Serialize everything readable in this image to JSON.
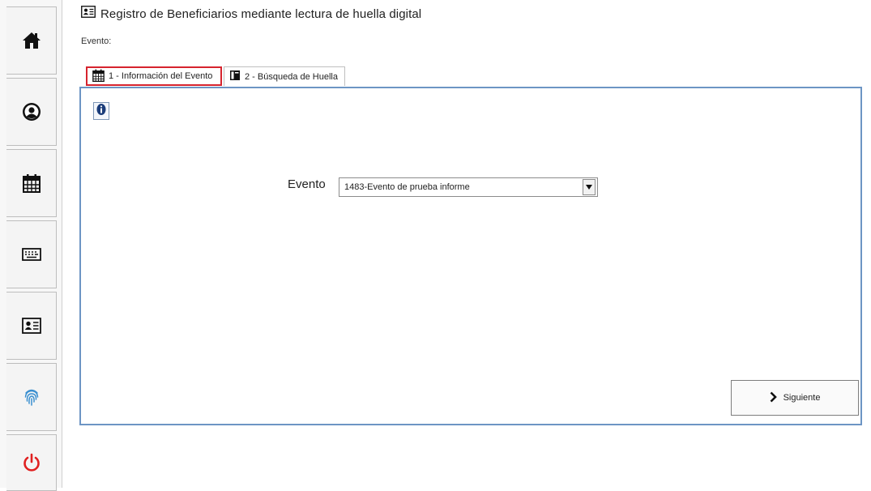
{
  "header": {
    "title": "Registro de Beneficiarios mediante lectura de huella digital",
    "title_icon": "id-card-icon"
  },
  "event_label": "Evento:",
  "tabs": [
    {
      "label": "1 - Información del Evento",
      "icon": "calendar-icon",
      "active": true
    },
    {
      "label": "2 - Búsqueda de Huella",
      "icon": "notebook-icon",
      "active": false
    }
  ],
  "sidebar": {
    "items": [
      {
        "icon": "home-icon"
      },
      {
        "icon": "user-circle-icon"
      },
      {
        "icon": "calendar-icon"
      },
      {
        "icon": "keyboard-icon"
      },
      {
        "icon": "id-card-icon"
      },
      {
        "icon": "fingerprint-icon"
      },
      {
        "icon": "power-icon"
      }
    ]
  },
  "form": {
    "event_field_label": "Evento",
    "event_select_value": "1483-Evento de prueba informe"
  },
  "next_button_label": "Siguiente",
  "colors": {
    "active_tab_border": "#d6242e",
    "panel_border": "#6d95c4",
    "power_icon": "#e02020",
    "fingerprint_icon": "#3a8fd0",
    "info_icon": "#1a3c7a"
  }
}
